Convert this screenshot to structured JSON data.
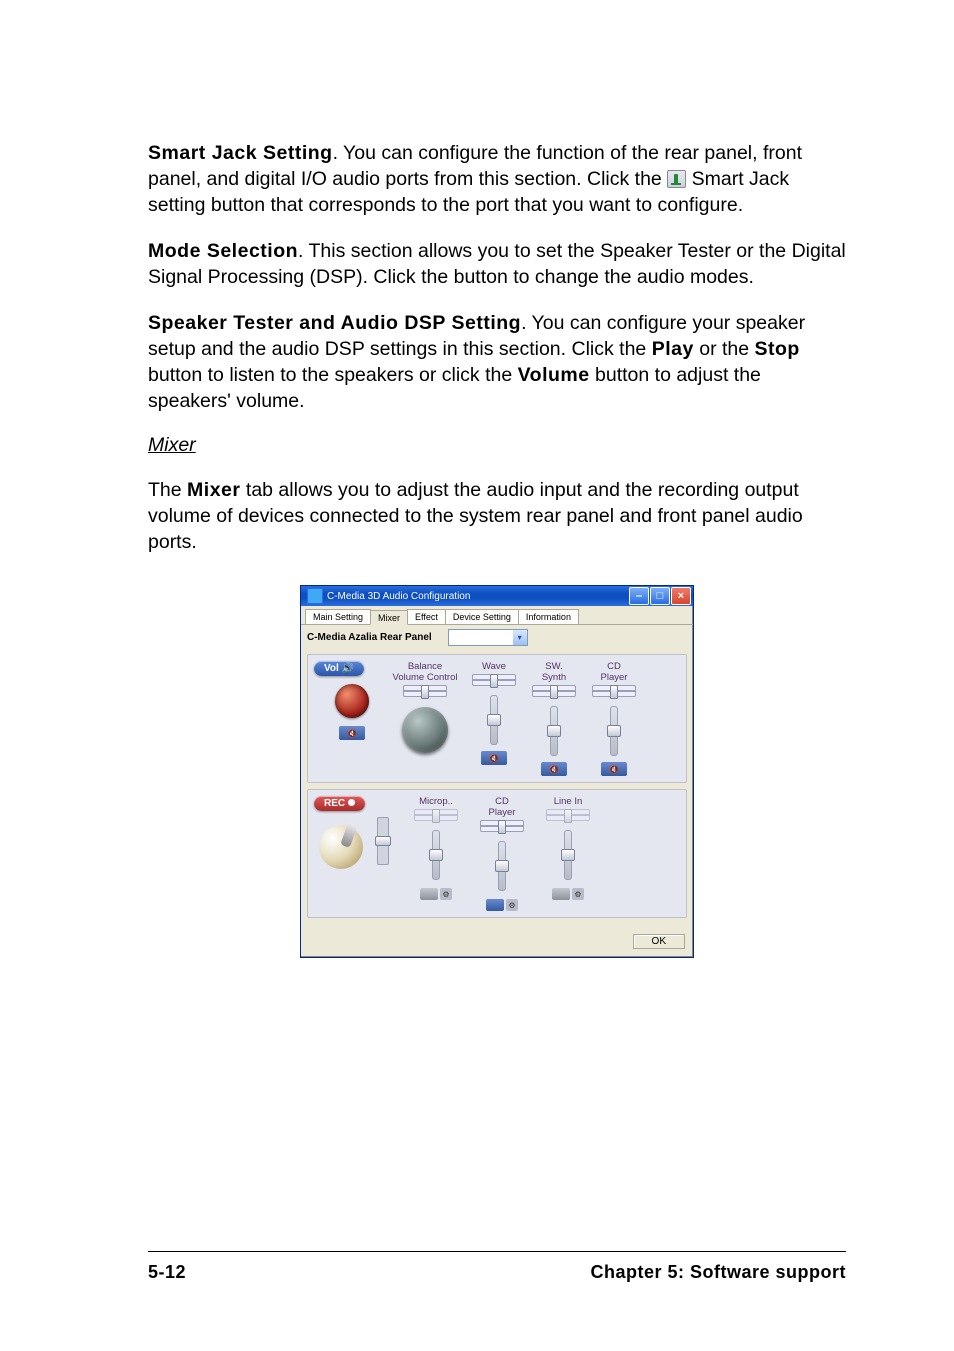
{
  "doc": {
    "p1_bold": "Smart Jack Setting",
    "p1_rest1": ". You can configure the function of the rear panel, front panel, and digital I/O audio ports from this section. Click the ",
    "p1_rest2": " Smart Jack setting button that corresponds to the port that you want to configure.",
    "p2_bold": "Mode Selection",
    "p2_rest": ". This section allows you to set the Speaker Tester or the Digital Signal Processing (DSP). Click the button to change the audio modes.",
    "p3_bold": "Speaker Tester and Audio DSP Setting",
    "p3_rest1": ". You can configure your speaker setup and the audio DSP settings in this section. Click the ",
    "p3_play": "Play",
    "p3_rest2": " or the ",
    "p3_stop": "Stop",
    "p3_rest3": " button to listen to the speakers or click the ",
    "p3_vol": "Volume",
    "p3_rest4": " button to adjust the speakers' volume.",
    "subheading": "Mixer",
    "p4_pre": "The ",
    "p4_bold": "Mixer",
    "p4_rest": " tab allows you to adjust the audio input and the recording output volume of devices connected to the system rear panel and front panel audio ports."
  },
  "win": {
    "title": "C-Media 3D Audio Configuration",
    "tabs": {
      "main": "Main Setting",
      "mixer": "Mixer",
      "effect": "Effect",
      "device": "Device Setting",
      "info": "Information"
    },
    "panel_label": "C-Media Azalia Rear Panel",
    "groups": {
      "vol": {
        "pill_label": "Vol",
        "balance_line1": "Balance",
        "balance_line2": "Volume Control",
        "channels": [
          {
            "line1": "Wave",
            "line2": ""
          },
          {
            "line1": "SW.",
            "line2": "Synth"
          },
          {
            "line1": "CD",
            "line2": "Player"
          }
        ]
      },
      "rec": {
        "pill_label": "REC",
        "channels": [
          {
            "line1": "Microp..",
            "line2": ""
          },
          {
            "line1": "CD",
            "line2": "Player"
          },
          {
            "line1": "Line In",
            "line2": ""
          }
        ]
      }
    },
    "ok": "OK"
  },
  "footer": {
    "left": "5-12",
    "right": "Chapter 5: Software support"
  }
}
